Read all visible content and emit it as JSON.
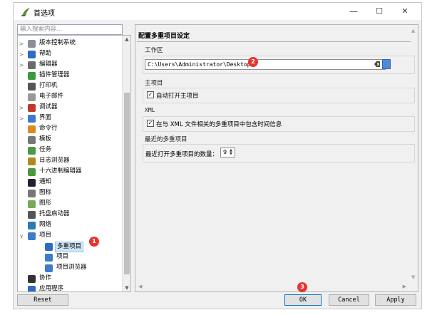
{
  "window": {
    "title": "首选项",
    "minimize": "—",
    "maximize": "☐",
    "close": "✕"
  },
  "search": {
    "placeholder": "输入搜索内容..."
  },
  "tree": {
    "items": [
      {
        "label": "版本控制系统",
        "arrow": ">",
        "icon": "vcs-icon"
      },
      {
        "label": "帮助",
        "arrow": ">",
        "icon": "help-icon"
      },
      {
        "label": "编辑器",
        "arrow": ">",
        "icon": "editor-icon"
      },
      {
        "label": "插件管理器",
        "arrow": "",
        "icon": "plugin-icon"
      },
      {
        "label": "打印机",
        "arrow": "",
        "icon": "printer-icon"
      },
      {
        "label": "电子邮件",
        "arrow": "",
        "icon": "email-icon"
      },
      {
        "label": "调试器",
        "arrow": ">",
        "icon": "debugger-icon"
      },
      {
        "label": "界面",
        "arrow": ">",
        "icon": "interface-icon"
      },
      {
        "label": "命令行",
        "arrow": "",
        "icon": "terminal-icon"
      },
      {
        "label": "模板",
        "arrow": "",
        "icon": "template-icon"
      },
      {
        "label": "任务",
        "arrow": "",
        "icon": "task-icon"
      },
      {
        "label": "日志浏览器",
        "arrow": "",
        "icon": "log-icon"
      },
      {
        "label": "十六进制编辑器",
        "arrow": "",
        "icon": "hex-icon"
      },
      {
        "label": "通知",
        "arrow": "",
        "icon": "notify-icon"
      },
      {
        "label": "图标",
        "arrow": "",
        "icon": "icon-icon"
      },
      {
        "label": "图形",
        "arrow": "",
        "icon": "graphics-icon"
      },
      {
        "label": "托盘启动器",
        "arrow": "",
        "icon": "tray-icon"
      },
      {
        "label": "网络",
        "arrow": "",
        "icon": "network-icon"
      },
      {
        "label": "项目",
        "arrow": "∨",
        "icon": "project-icon"
      },
      {
        "label": "多重项目",
        "arrow": "",
        "icon": "multiproject-icon",
        "child": true,
        "selected": true
      },
      {
        "label": "项目",
        "arrow": "",
        "icon": "project-icon",
        "child": true
      },
      {
        "label": "项目浏览器",
        "arrow": "",
        "icon": "project-browser-icon",
        "child": true
      },
      {
        "label": "协作",
        "arrow": "",
        "icon": "collab-icon"
      },
      {
        "label": "应用程序",
        "arrow": "",
        "icon": "app-icon"
      }
    ]
  },
  "panel": {
    "title": "配置多重项目设定",
    "workspace_group": "工作区",
    "workspace_path": "C:\\Users\\Administrator\\Desktop",
    "main_project_group": "主项目",
    "auto_open_label": "自动打开主项目",
    "auto_open_checked": true,
    "xml_group": "XML",
    "xml_label": "在与 XML 文件相关的多重项目中包含时间信息",
    "xml_checked": true,
    "recent_group": "最近的多重项目",
    "recent_count_label": "最近打开多重项目的数量：",
    "recent_count": "9"
  },
  "buttons": {
    "reset": "Reset",
    "ok": "OK",
    "cancel": "Cancel",
    "apply": "Apply"
  },
  "badges": {
    "b1": "1",
    "b2": "2",
    "b3": "3"
  },
  "colors": {
    "badge": "#e8352c",
    "selection": "#cde6f7",
    "focus": "#0078d7"
  }
}
